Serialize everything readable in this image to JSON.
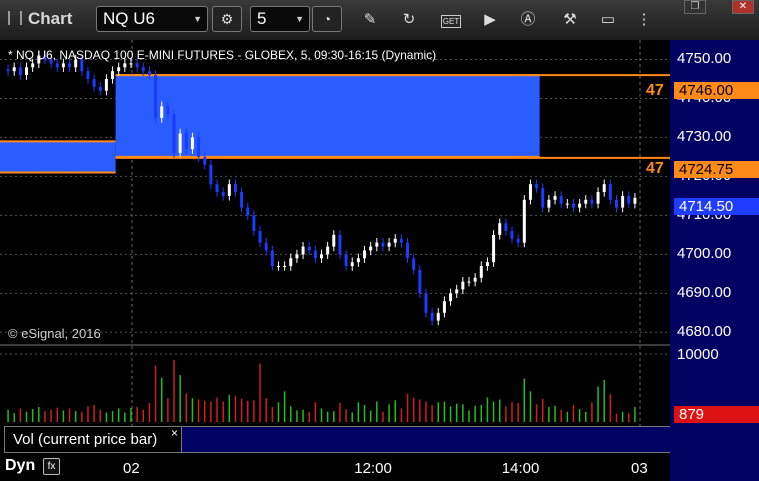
{
  "toolbar": {
    "title": "Chart",
    "symbol": "NQ U6",
    "interval": "5"
  },
  "window_buttons": {
    "restore": "❐",
    "close": "✕"
  },
  "chart_description": "* NQ U6, NASDAQ 100 E-MINI FUTURES - GLOBEX, 5, 09:30-16:15 (Dynamic)",
  "copyright": "© eSignal, 2016",
  "colors": {
    "up": "#ffffff",
    "down": "#1a3cff",
    "zone": "#2a5cff",
    "level": "#ff8a1a",
    "vol_up": "#1fbf1f",
    "vol_down": "#d21d1d",
    "last_tag": "#1f3cff",
    "vol_tag": "#dd1111"
  },
  "vol_legend": "Vol (current price bar)",
  "dyn_label": "Dyn",
  "chart_data": [
    {
      "type": "candlestick",
      "title": "* NQ U6, NASDAQ 100 E-MINI FUTURES - GLOBEX, 5, 09:30-16:15 (Dynamic)",
      "ylim": [
        4677,
        4755
      ],
      "y_ticks": [
        "4750.00",
        "4740.00",
        "4730.00",
        "4720.00",
        "4710.00",
        "4700.00",
        "4690.00",
        "4680.00"
      ],
      "x_ticks": [
        "02",
        "12:00",
        "14:00",
        "03"
      ],
      "levels": [
        {
          "label": "4746.00",
          "short": "47",
          "value": 4746.0
        },
        {
          "label": "4724.75",
          "short": "47",
          "value": 4724.75
        }
      ],
      "last_price": "4714.50",
      "zones": [
        {
          "from_bar": 0,
          "to_bar": 17,
          "low": 4721,
          "high": 4729
        },
        {
          "from_bar": 18,
          "to_bar": 86,
          "low": 4725,
          "high": 4746
        }
      ],
      "closes": [
        4747,
        4748,
        4746,
        4748,
        4749,
        4751,
        4750,
        4749,
        4748,
        4749,
        4748,
        4750,
        4747,
        4745,
        4743,
        4742,
        4745,
        4747,
        4748,
        4749,
        4749,
        4748,
        4747,
        4746,
        4735,
        4738,
        4736,
        4726,
        4731,
        4727,
        4730,
        4725,
        4723,
        4718,
        4716,
        4715,
        4718,
        4716,
        4712,
        4710,
        4706,
        4703,
        4701,
        4697,
        4697,
        4697,
        4699,
        4700,
        4702,
        4701,
        4699,
        4700,
        4702,
        4705,
        4700,
        4697,
        4698,
        4699,
        4701,
        4702,
        4703,
        4702,
        4703,
        4704,
        4703,
        4699,
        4696,
        4690,
        4685,
        4683,
        4685,
        4688,
        4690,
        4691,
        4693,
        4693,
        4694,
        4697,
        4698,
        4705,
        4708,
        4706,
        4704,
        4703,
        4714,
        4718,
        4717,
        4712,
        4714,
        4715,
        4713,
        4713,
        4712,
        4713,
        4714,
        4713,
        4716,
        4718,
        4714,
        4712,
        4715,
        4713,
        4714.5
      ]
    },
    {
      "type": "bar",
      "title": "Vol (current price bar)",
      "ylim": [
        0,
        10000
      ],
      "y_ticks": [
        "10000"
      ],
      "last_value": "879",
      "values": [
        1800,
        1300,
        2000,
        1500,
        1900,
        2200,
        1600,
        1800,
        2100,
        1700,
        2000,
        1600,
        1500,
        2300,
        2500,
        1800,
        1400,
        1600,
        2000,
        1400,
        2100,
        2200,
        1800,
        2800,
        8300,
        6500,
        3500,
        9100,
        6900,
        4200,
        3500,
        3300,
        3100,
        3000,
        3600,
        3000,
        4000,
        3800,
        3400,
        3100,
        3200,
        8600,
        3500,
        2200,
        2900,
        4500,
        2300,
        1700,
        1800,
        1500,
        2900,
        2000,
        1500,
        1600,
        2800,
        1900,
        1400,
        2900,
        2500,
        1700,
        3000,
        1500,
        2600,
        3200,
        2000,
        4100,
        3600,
        3300,
        3000,
        2500,
        2900,
        3000,
        2300,
        2700,
        2600,
        1700,
        2400,
        2500,
        3600,
        3000,
        3300,
        2300,
        2900,
        2800,
        6400,
        4500,
        2600,
        3400,
        2200,
        2400,
        1800,
        1500,
        2500,
        1900,
        1500,
        2900,
        5200,
        6200,
        4100,
        1200,
        1500,
        1300,
        2200
      ]
    }
  ]
}
